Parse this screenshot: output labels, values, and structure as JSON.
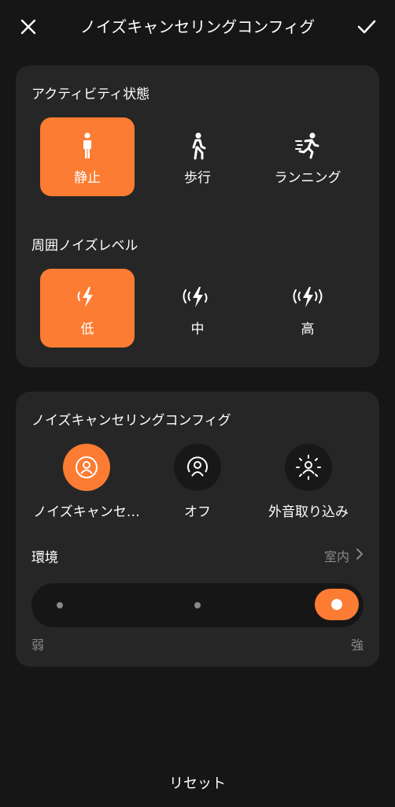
{
  "header": {
    "title": "ノイズキャンセリングコンフィグ",
    "close_icon": "close-icon",
    "confirm_icon": "check-icon"
  },
  "activity": {
    "label": "アクティビティ状態",
    "options": [
      {
        "label": "静止",
        "icon": "person-standing-icon",
        "selected": true
      },
      {
        "label": "歩行",
        "icon": "person-walking-icon",
        "selected": false
      },
      {
        "label": "ランニング",
        "icon": "person-running-icon",
        "selected": false
      }
    ]
  },
  "noise_level": {
    "label": "周囲ノイズレベル",
    "options": [
      {
        "label": "低",
        "icon": "noise-low-icon",
        "selected": true
      },
      {
        "label": "中",
        "icon": "noise-medium-icon",
        "selected": false
      },
      {
        "label": "高",
        "icon": "noise-high-icon",
        "selected": false
      }
    ]
  },
  "nc_config": {
    "label": "ノイズキャンセリングコンフィグ",
    "modes": [
      {
        "label": "ノイズキャンセ…",
        "icon": "noise-cancel-icon",
        "selected": true
      },
      {
        "label": "オフ",
        "icon": "anc-off-icon",
        "selected": false
      },
      {
        "label": "外音取り込み",
        "icon": "ambient-sound-icon",
        "selected": false
      }
    ],
    "environment": {
      "label": "環境",
      "value": "室内"
    },
    "strength": {
      "min_label": "弱",
      "max_label": "強",
      "level": "強",
      "steps": 3,
      "selected_step": 3
    }
  },
  "footer": {
    "reset_label": "リセット"
  },
  "colors": {
    "accent": "#fb7c32",
    "background": "#161616",
    "card": "#262626",
    "muted": "#8a8a8a"
  }
}
